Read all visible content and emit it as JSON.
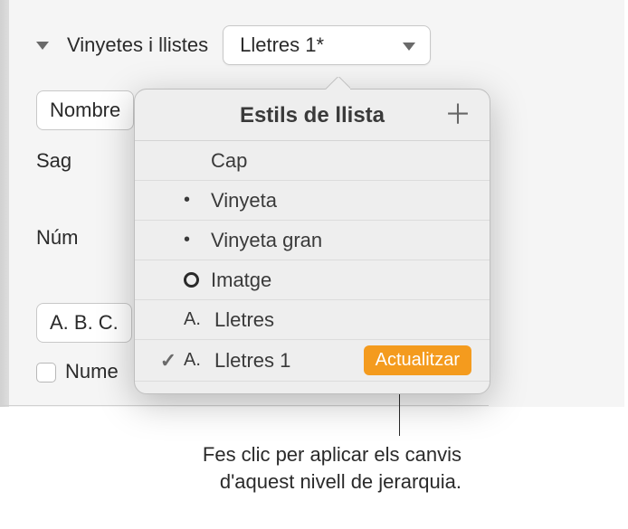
{
  "header": {
    "section_label": "Vinyetes i llistes",
    "popup_value": "Lletres 1*"
  },
  "partial_rows": {
    "nombre": "Nombre",
    "sag": "Sag",
    "num": "Núm",
    "abc": "A. B. C.",
    "nume": "Nume"
  },
  "popover": {
    "title": "Estils de llista",
    "items": {
      "cap": "Cap",
      "vinyeta": "Vinyeta",
      "vinyeta_gran": "Vinyeta gran",
      "imatge": "Imatge",
      "lletres_prefix": "A.",
      "lletres": "Lletres",
      "lletres1_prefix": "A.",
      "lletres1": "Lletres 1"
    },
    "update_label": "Actualitzar"
  },
  "callout": {
    "text": "Fes clic per aplicar els canvis d'aquest nivell de jerarquia."
  }
}
